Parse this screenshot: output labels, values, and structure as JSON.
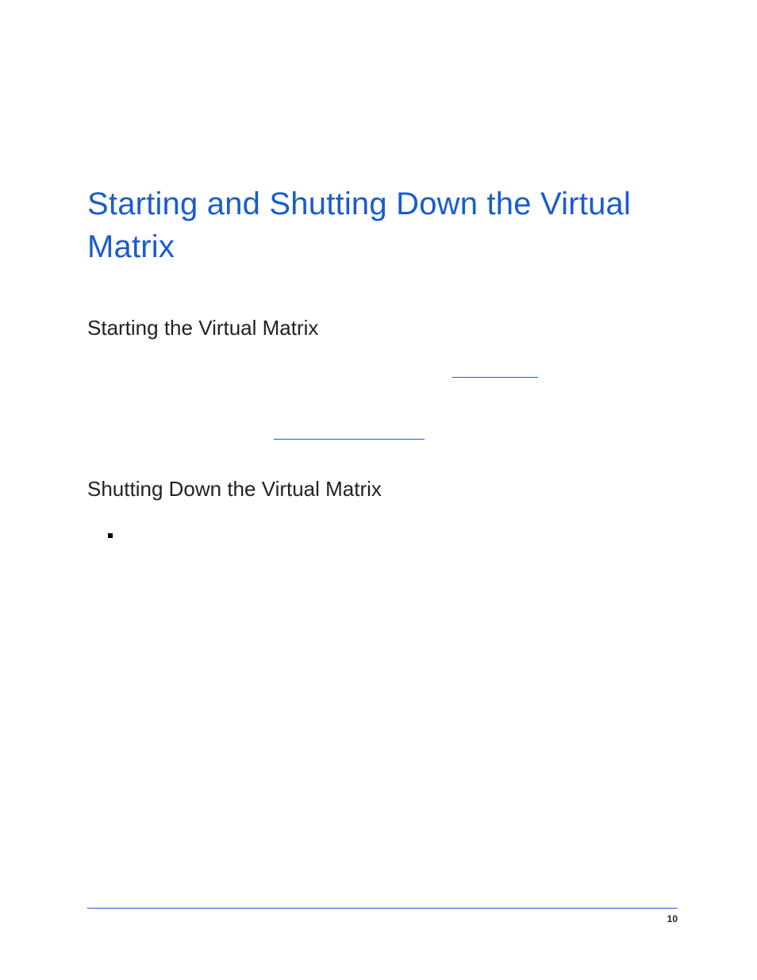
{
  "chapter": {
    "title": "Starting and Shutting Down the Virtual Matrix"
  },
  "sections": {
    "starting": {
      "title": "Starting the Virtual Matrix"
    },
    "shutdown": {
      "title": "Shutting Down the Virtual Matrix"
    }
  },
  "links": {
    "link1_label": "",
    "link2_label": ""
  },
  "footer": {
    "page_number": "10"
  }
}
